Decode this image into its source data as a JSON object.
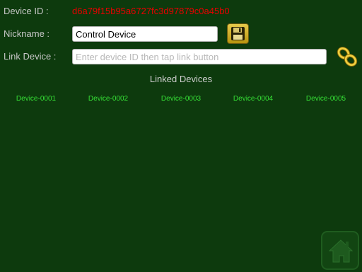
{
  "device": {
    "id_label": "Device ID :",
    "id_value": "d6a79f15b95a6727fc3d97879c0a45b0"
  },
  "nickname": {
    "label": "Nickname :",
    "value": "Control Device"
  },
  "link": {
    "label": "Link Device :",
    "placeholder": "Enter device ID then tap link button"
  },
  "linked_devices": {
    "title": "Linked Devices",
    "items": [
      "Device-0001",
      "Device-0002",
      "Device-0003",
      "Device-0004",
      "Device-0005"
    ]
  },
  "icons": {
    "save": "floppy-disk-icon",
    "link": "chain-link-icon",
    "home": "home-icon"
  },
  "colors": {
    "background": "#0d3a0d",
    "device_id": "#e80000",
    "device_item": "#36e036",
    "save_button": "#d4b21e",
    "link_icon": "#e0c020"
  }
}
